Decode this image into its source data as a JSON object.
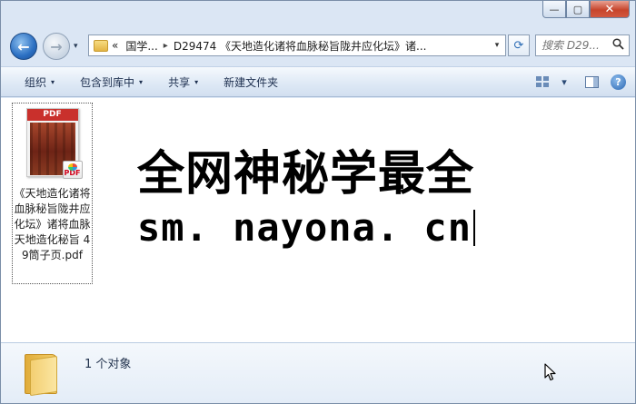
{
  "window": {
    "caption_buttons": {
      "minimize": "—",
      "maximize": "▢",
      "close": "✕"
    }
  },
  "nav": {
    "back_glyph": "←",
    "forward_glyph": "→",
    "dropdown_glyph": "▾"
  },
  "address": {
    "overflow": "«",
    "crumb_root": "国学...",
    "separator": "▸",
    "crumb_current": "D29474 《天地造化诸将血脉秘旨陇井应化坛》诸...",
    "dropdown_glyph": "▾"
  },
  "refresh_glyph": "⟳",
  "search": {
    "placeholder": "搜索 D29...",
    "icon": "search-icon"
  },
  "toolbar": {
    "organize": "组织",
    "include_in_library": "包含到库中",
    "share": "共享",
    "new_folder": "新建文件夹",
    "arrow": "▾",
    "help_glyph": "?"
  },
  "file": {
    "thumb_banner": "PDF",
    "badge": "PDF",
    "name": "《天地造化诸将血脉秘旨陇井应化坛》诸将血脉天地造化秘旨 49筒子页.pdf"
  },
  "watermark": {
    "line1": "全网神秘学最全",
    "line2": "sm. nayona. cn"
  },
  "status": {
    "count": "1 个对象"
  },
  "colors": {
    "window_bg": "#dbe6f4",
    "content_bg": "#ffffff",
    "close_red": "#c7452c",
    "pdf_red": "#c9302c"
  }
}
